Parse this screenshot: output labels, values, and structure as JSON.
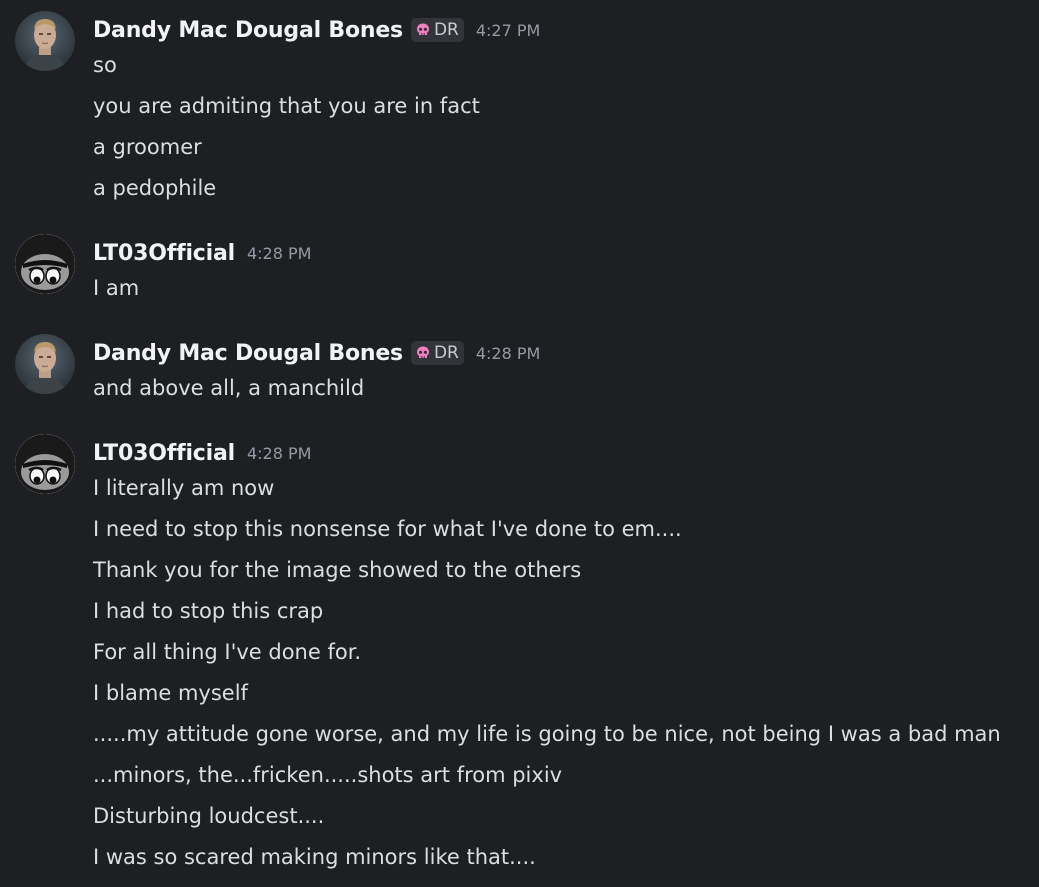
{
  "messages": [
    {
      "author": "Dandy Mac Dougal Bones",
      "tag": "DR",
      "timestamp": "4:27 PM",
      "lines": [
        "so",
        "you are admiting that you are in fact",
        "a groomer",
        "a pedophile"
      ]
    },
    {
      "author": "LT03Official",
      "timestamp": "4:28 PM",
      "lines": [
        "I am"
      ]
    },
    {
      "author": "Dandy Mac Dougal Bones",
      "tag": "DR",
      "timestamp": "4:28 PM",
      "lines": [
        "and above all, a manchild"
      ]
    },
    {
      "author": "LT03Official",
      "timestamp": "4:28 PM",
      "lines": [
        "I literally am now",
        "I need to stop this nonsense for what I've done to em....",
        "Thank you for the image showed to the others",
        "I had to stop this crap",
        "For all thing I've done for.",
        "I blame myself",
        ".....my attitude gone worse, and my life is going to be nice, not being I was a bad man",
        "...minors, the...fricken.....shots art from pixiv",
        "Disturbing loudcest....",
        "I was so scared making minors like that...."
      ]
    }
  ],
  "colors": {
    "background": "#1e1f22",
    "username": "#f2f3f5",
    "text": "#dbdee1",
    "timestamp": "#949ba4",
    "tag_bg": "#33343a",
    "tag_icon": "#f47fbf"
  },
  "icons": {
    "tag_icon": "skull-icon",
    "avatar_dandy": "man-portrait-avatar",
    "avatar_lt03": "cartoon-face-avatar"
  }
}
